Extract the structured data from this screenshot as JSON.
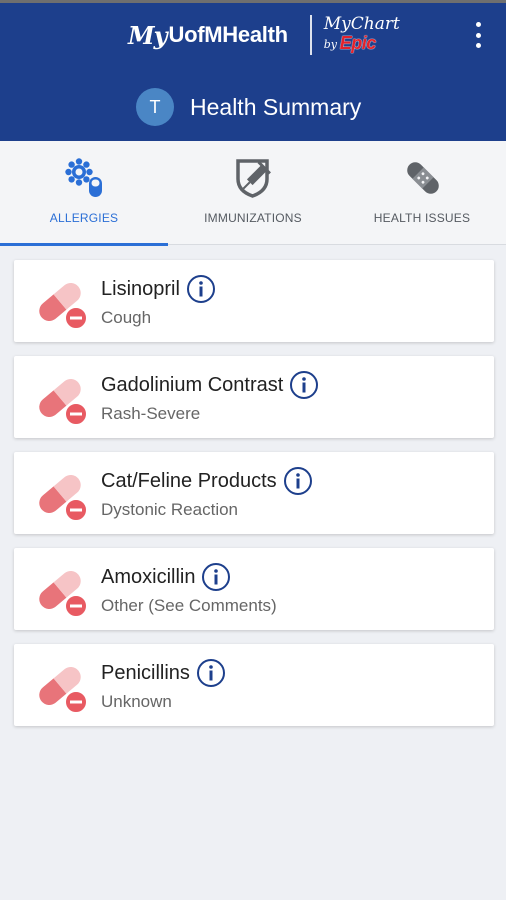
{
  "header": {
    "brand_my": "My",
    "brand_name": "UofMHealth",
    "partner_mychart": "MyChart",
    "partner_by": "by",
    "partner_epic": "Epic",
    "menu_icon": "kebab-menu-icon",
    "avatar_initial": "T",
    "title": "Health Summary",
    "background_color": "#1d3f8c"
  },
  "tabs": [
    {
      "label": "ALLERGIES",
      "icon": "allergies-icon",
      "active": true
    },
    {
      "label": "IMMUNIZATIONS",
      "icon": "syringe-shield-icon",
      "active": false
    },
    {
      "label": "HEALTH ISSUES",
      "icon": "bandage-icon",
      "active": false
    }
  ],
  "accent_color": "#2b6fd6",
  "allergies": [
    {
      "name": "Lisinopril",
      "reaction": "Cough"
    },
    {
      "name": "Gadolinium Contrast",
      "reaction": "Rash-Severe"
    },
    {
      "name": "Cat/Feline Products",
      "reaction": "Dystonic Reaction"
    },
    {
      "name": "Amoxicillin",
      "reaction": "Other (See Comments)"
    },
    {
      "name": "Penicillins",
      "reaction": "Unknown"
    }
  ],
  "allergy_icon": "pill-minus-icon",
  "info_icon": "info-icon"
}
